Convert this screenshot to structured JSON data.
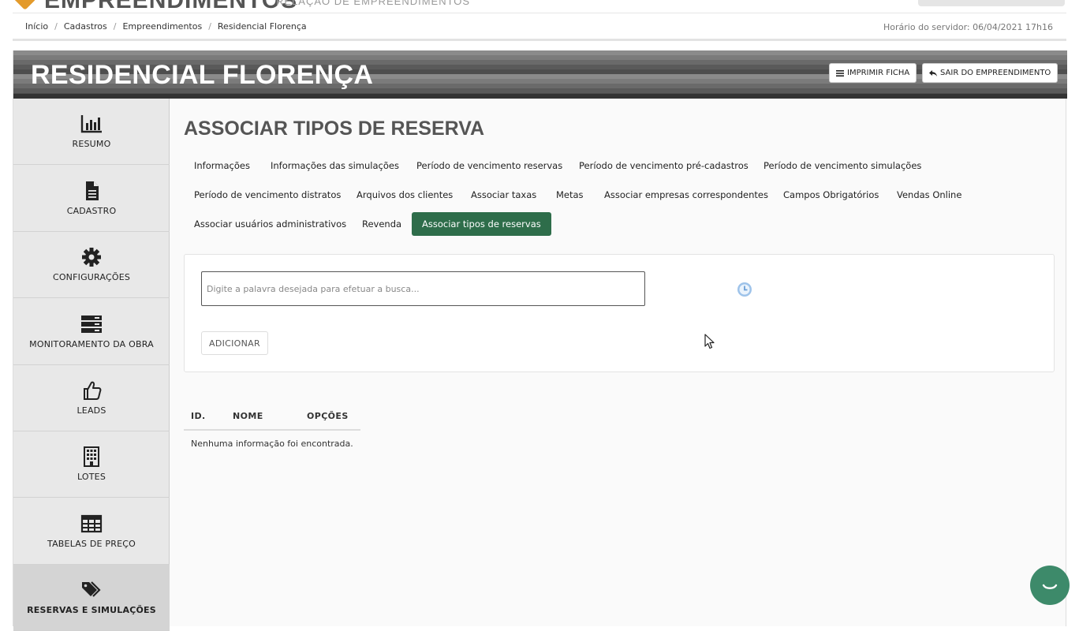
{
  "app": {
    "title": "EMPREENDIMENTOS",
    "subtitle": "RELAÇÃO DE EMPREENDIMENTOS"
  },
  "breadcrumb": [
    "Início",
    "Cadastros",
    "Empreendimentos",
    "Residencial Florença"
  ],
  "server_time": "Horário do servidor: 06/04/2021 17h16",
  "banner": {
    "title": "RESIDENCIAL FLORENÇA",
    "print_label": "IMPRIMIR FICHA",
    "exit_label": "SAIR DO EMPREENDIMENTO"
  },
  "sidebar": {
    "items": [
      {
        "label": "RESUMO",
        "icon": "bar-chart-icon"
      },
      {
        "label": "CADASTRO",
        "icon": "document-icon"
      },
      {
        "label": "CONFIGURAÇÕES",
        "icon": "gear-icon"
      },
      {
        "label": "MONITORAMENTO DA OBRA",
        "icon": "server-icon"
      },
      {
        "label": "LEADS",
        "icon": "thumbs-up-icon"
      },
      {
        "label": "LOTES",
        "icon": "building-icon"
      },
      {
        "label": "TABELAS DE PREÇO",
        "icon": "table-icon"
      },
      {
        "label": "RESERVAS E SIMULAÇÕES",
        "icon": "tags-icon",
        "active": true
      }
    ]
  },
  "main": {
    "title": "ASSOCIAR TIPOS DE RESERVA",
    "tabs": [
      "Informações",
      "Informações das simulações",
      "Período de vencimento reservas",
      "Período de vencimento pré-cadastros",
      "Período de vencimento simulações",
      "Período de vencimento distratos",
      "Arquivos dos clientes",
      "Associar taxas",
      "Metas",
      "Associar empresas correspondentes",
      "Campos Obrigatórios",
      "Vendas Online",
      "Associar usuários administrativos",
      "Revenda",
      "Associar tipos de reservas"
    ],
    "active_tab": "Associar tipos de reservas",
    "search": {
      "placeholder": "Digite a palavra desejada para efetuar a busca...",
      "value": ""
    },
    "add_label": "ADICIONAR",
    "table": {
      "columns": [
        "ID.",
        "NOME",
        "OPÇÕES"
      ],
      "empty_message": "Nenhuma informação foi encontrada."
    }
  },
  "colors": {
    "accent": "#2e6d4a",
    "chat": "#3d8a6a",
    "logo": "#e39a2b"
  }
}
